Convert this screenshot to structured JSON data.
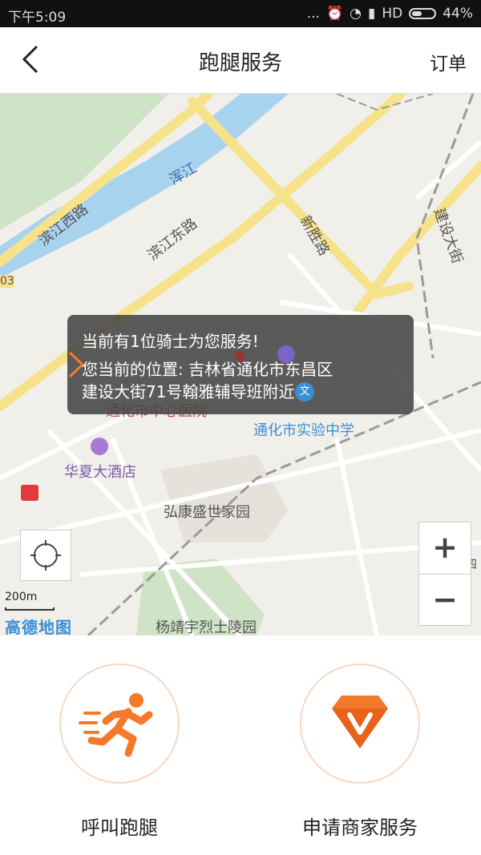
{
  "status_bar": {
    "time": "下午5:09",
    "dots": "...",
    "network": "HD",
    "battery": "44%"
  },
  "header": {
    "title": "跑腿服务",
    "orders": "订单"
  },
  "map": {
    "labels": {
      "river": "浑江",
      "road_binjiang_west": "滨江西路",
      "road_binjiang_east": "滨江东路",
      "road_xinsheng": "新胜路",
      "road_jianshe": "建设大街",
      "road_number": "03",
      "hospital": "通化市中心医院",
      "school": "通化市实验中学",
      "school_badge": "文",
      "hotel": "华夏大酒店",
      "garden": "弘康盛世家园",
      "cemetery": "杨靖宇烈士陵园",
      "edge_char": "四"
    },
    "scale": "200m",
    "provider": "高德地图",
    "zoom_in": "+",
    "zoom_out": "−"
  },
  "info_card": {
    "line1": "当前有1位骑士为您服务!",
    "line2": "您当前的位置: 吉林省通化市东昌区",
    "line3": "建设大街71号翰雅辅导班附近"
  },
  "actions": [
    {
      "label": "呼叫跑腿",
      "icon": "running-man-icon"
    },
    {
      "label": "申请商家服务",
      "icon": "diamond-v-icon"
    }
  ],
  "colors": {
    "accent": "#f5792a",
    "road_yellow": "#f7e28c",
    "river": "#a8d3ef",
    "park": "#cfe3c6"
  }
}
